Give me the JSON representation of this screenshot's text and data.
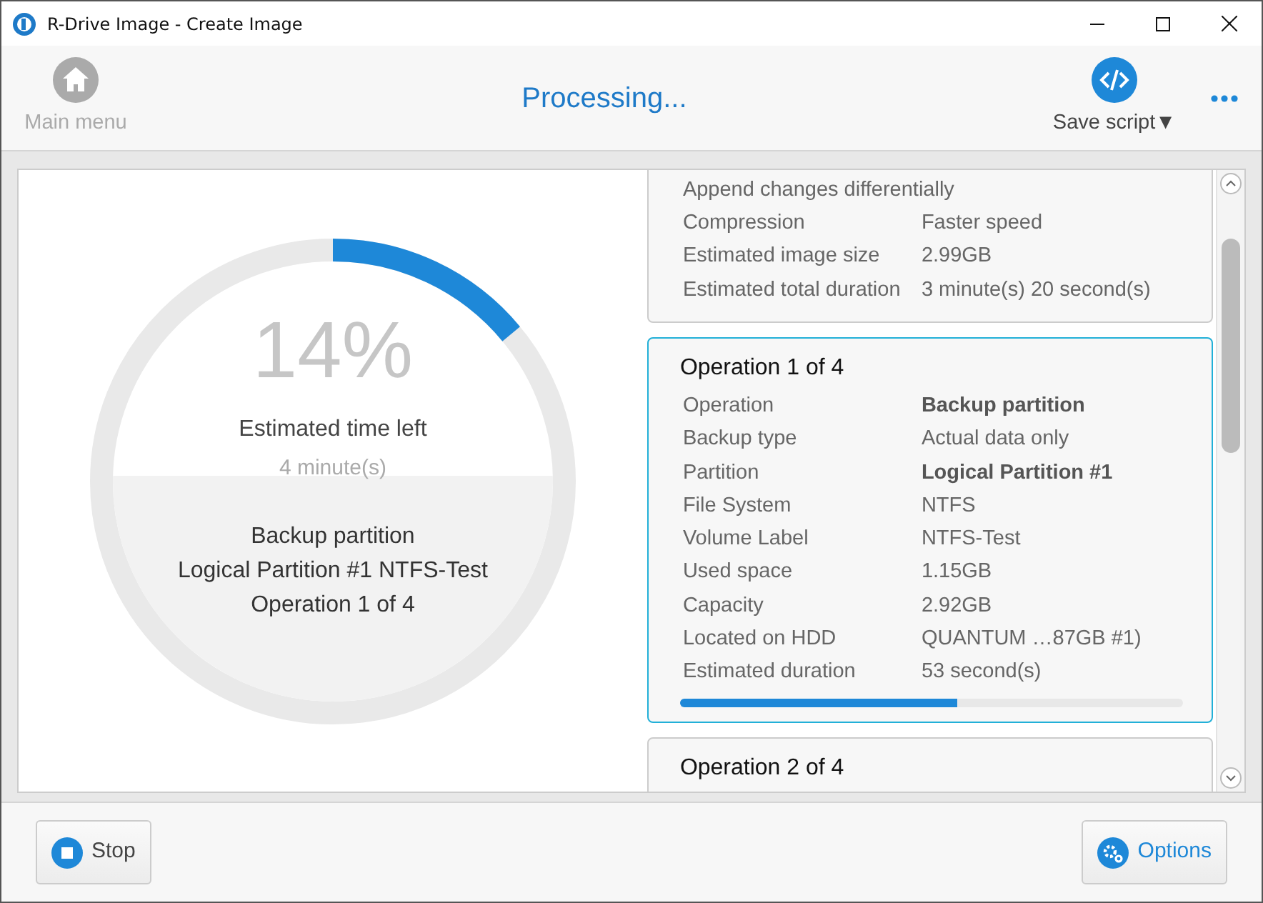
{
  "window": {
    "title": "R-Drive Image - Create Image"
  },
  "toolbar": {
    "main_menu": "Main menu",
    "heading": "Processing...",
    "save_script": "Save script▼"
  },
  "progress": {
    "percent": "14%",
    "time_label": "Estimated time left",
    "time_value": "4 minute(s)",
    "lines": [
      "Backup partition",
      "Logical Partition #1 NTFS-Test",
      "Operation 1 of 4"
    ]
  },
  "summary": {
    "note": "Append changes differentially",
    "rows": [
      {
        "label": "Compression",
        "value": "Faster speed"
      },
      {
        "label": "Estimated image size",
        "value": "2.99GB"
      },
      {
        "label": "Estimated total duration",
        "value": "3 minute(s) 20 second(s)"
      }
    ]
  },
  "operations": [
    {
      "title": "Operation 1 of 4",
      "selected": true,
      "level": 0.55,
      "rows": [
        {
          "label": "Operation",
          "value": "Backup partition",
          "bold": true
        },
        {
          "label": "Backup type",
          "value": "Actual data only",
          "bold": false
        },
        {
          "label": "Partition",
          "value": "Logical Partition #1",
          "bold": true
        },
        {
          "label": "File System",
          "value": "NTFS",
          "bold": false
        },
        {
          "label": "Volume Label",
          "value": "NTFS-Test",
          "bold": false
        },
        {
          "label": "Used space",
          "value": "1.15GB",
          "bold": false
        },
        {
          "label": "Capacity",
          "value": "2.92GB",
          "bold": false
        },
        {
          "label": "Located on HDD",
          "value": "QUANTUM …87GB #1)",
          "bold": false
        },
        {
          "label": "Estimated duration",
          "value": "53 second(s)",
          "bold": false
        }
      ]
    },
    {
      "title": "Operation 2 of 4",
      "selected": false
    }
  ],
  "buttons": {
    "stop": "Stop",
    "options": "Options"
  }
}
